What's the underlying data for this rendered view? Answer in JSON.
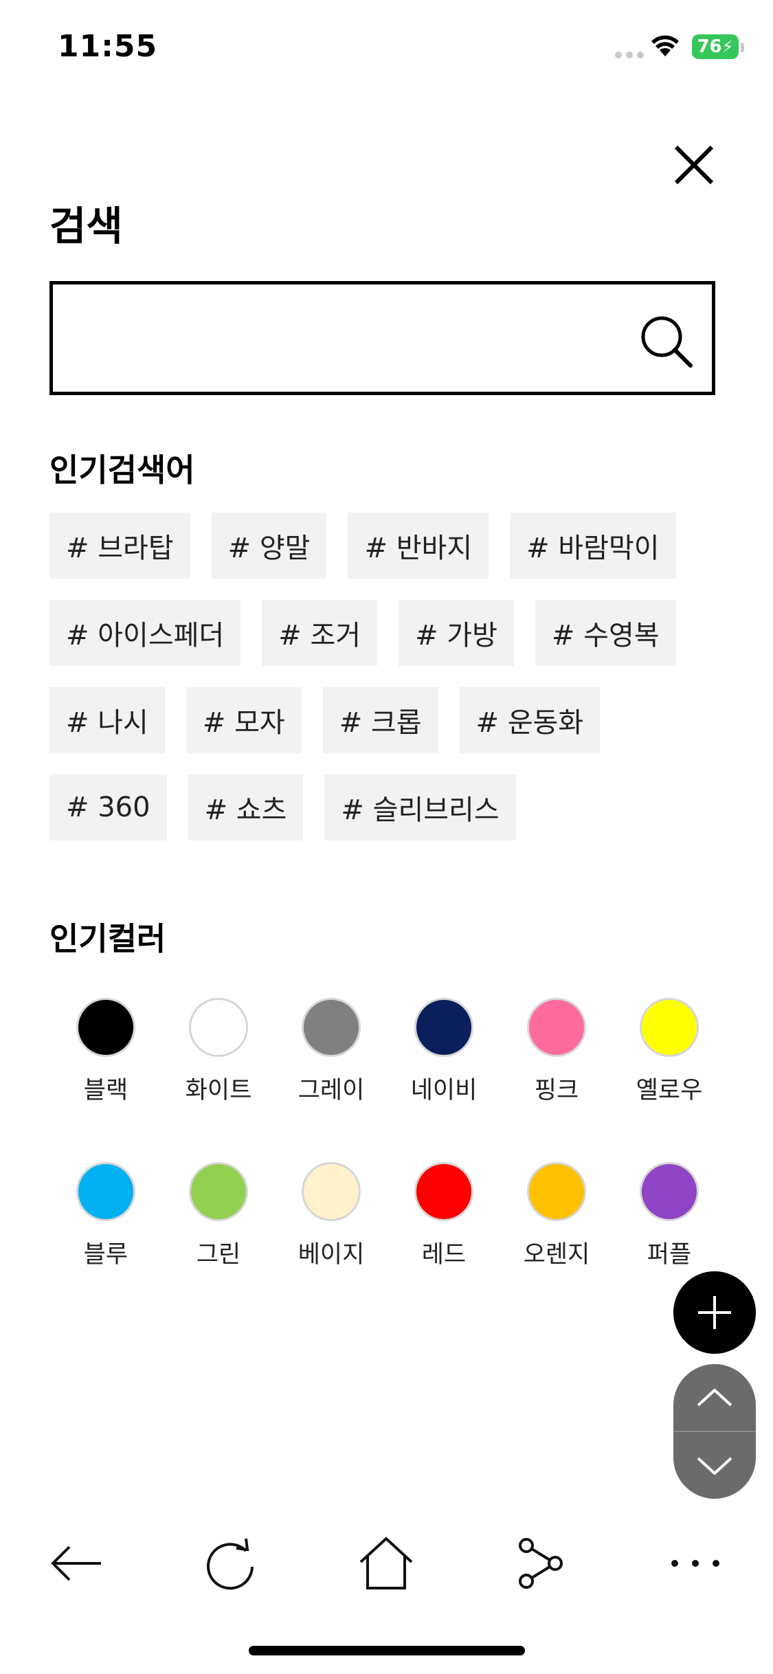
{
  "status_bar": {
    "time": "11:55",
    "battery": "76"
  },
  "header": {
    "title": "검색"
  },
  "search": {
    "placeholder": "",
    "value": ""
  },
  "popular_keywords": {
    "title": "인기검색어",
    "rows": [
      [
        "# 브라탑",
        "# 양말",
        "# 반바지",
        "# 바람막이"
      ],
      [
        "# 아이스페더",
        "# 조거",
        "# 가방",
        "# 수영복"
      ],
      [
        "# 나시",
        "# 모자",
        "# 크롭",
        "# 운동화"
      ],
      [
        "# 360",
        "# 쇼츠",
        "# 슬리브리스"
      ]
    ]
  },
  "popular_colors": {
    "title": "인기컬러",
    "items": [
      {
        "label": "블랙",
        "color": "#000000"
      },
      {
        "label": "화이트",
        "color": "#ffffff"
      },
      {
        "label": "그레이",
        "color": "#808080"
      },
      {
        "label": "네이비",
        "color": "#0a1f5c"
      },
      {
        "label": "핑크",
        "color": "#ff6b9d"
      },
      {
        "label": "옐로우",
        "color": "#ffff00"
      },
      {
        "label": "블루",
        "color": "#00b0f0"
      },
      {
        "label": "그린",
        "color": "#92d050"
      },
      {
        "label": "베이지",
        "color": "#fff2cc"
      },
      {
        "label": "레드",
        "color": "#ff0000"
      },
      {
        "label": "오렌지",
        "color": "#ffc000"
      },
      {
        "label": "퍼플",
        "color": "#8e44c4"
      }
    ]
  },
  "icons": {
    "close": "close-icon",
    "search": "search-icon",
    "add": "plus-icon",
    "scroll_up": "chevron-up-icon",
    "scroll_down": "chevron-down-icon",
    "back": "arrow-left-icon",
    "refresh": "refresh-icon",
    "home": "home-icon",
    "share": "share-icon",
    "more": "more-icon"
  }
}
